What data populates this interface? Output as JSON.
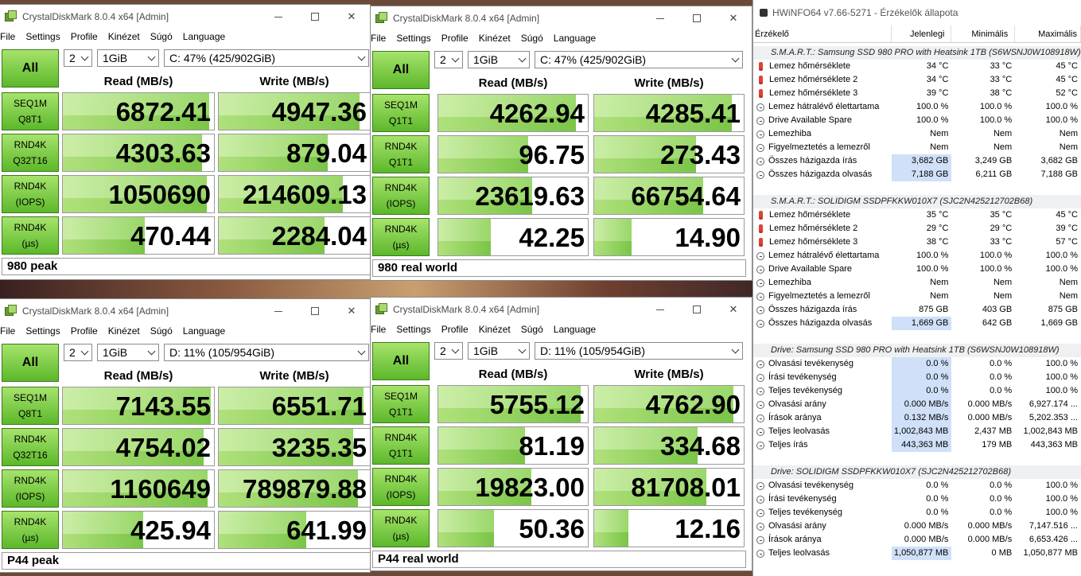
{
  "cdm": {
    "menu": [
      "File",
      "Settings",
      "Profile",
      "Kinézet",
      "Súgó",
      "Language"
    ],
    "all_label": "All",
    "read_header": "Read (MB/s)",
    "write_header": "Write (MB/s)",
    "title": "CrystalDiskMark 8.0.4 x64 [Admin]",
    "windows": [
      {
        "count": "2",
        "size": "1GiB",
        "drive": "C: 47% (425/902GiB)",
        "comment": "980 peak",
        "rows": [
          {
            "l1": "SEQ1M",
            "l2": "Q8T1",
            "read": "6872.41",
            "write": "4947.36",
            "rf": 0.97,
            "wf": 0.93
          },
          {
            "l1": "RND4K",
            "l2": "Q32T16",
            "read": "4303.63",
            "write": "879.04",
            "rf": 0.92,
            "wf": 0.72
          },
          {
            "l1": "RND4K",
            "l2": "(IOPS)",
            "read": "1050690",
            "write": "214609.13",
            "rf": 0.95,
            "wf": 0.82
          },
          {
            "l1": "RND4K",
            "l2": "(µs)",
            "read": "470.44",
            "write": "2284.04",
            "rf": 0.54,
            "wf": 0.7
          }
        ]
      },
      {
        "count": "2",
        "size": "1GiB",
        "drive": "C: 47% (425/902GiB)",
        "comment": "980 real world",
        "rows": [
          {
            "l1": "SEQ1M",
            "l2": "Q1T1",
            "read": "4262.94",
            "write": "4285.41",
            "rf": 0.92,
            "wf": 0.92
          },
          {
            "l1": "RND4K",
            "l2": "Q1T1",
            "read": "96.75",
            "write": "273.43",
            "rf": 0.6,
            "wf": 0.68
          },
          {
            "l1": "RND4K",
            "l2": "(IOPS)",
            "read": "23619.63",
            "write": "66754.64",
            "rf": 0.63,
            "wf": 0.73
          },
          {
            "l1": "RND4K",
            "l2": "(µs)",
            "read": "42.25",
            "write": "14.90",
            "rf": 0.35,
            "wf": 0.25
          }
        ]
      },
      {
        "count": "2",
        "size": "1GiB",
        "drive": "D: 11% (105/954GiB)",
        "comment": "P44 peak",
        "rows": [
          {
            "l1": "SEQ1M",
            "l2": "Q8T1",
            "read": "7143.55",
            "write": "6551.71",
            "rf": 0.98,
            "wf": 0.96
          },
          {
            "l1": "RND4K",
            "l2": "Q32T16",
            "read": "4754.02",
            "write": "3235.35",
            "rf": 0.93,
            "wf": 0.89
          },
          {
            "l1": "RND4K",
            "l2": "(IOPS)",
            "read": "1160649",
            "write": "789879.88",
            "rf": 0.96,
            "wf": 0.92
          },
          {
            "l1": "RND4K",
            "l2": "(µs)",
            "read": "425.94",
            "write": "641.99",
            "rf": 0.53,
            "wf": 0.58
          }
        ]
      },
      {
        "count": "2",
        "size": "1GiB",
        "drive": "D: 11% (105/954GiB)",
        "comment": "P44 real world",
        "rows": [
          {
            "l1": "SEQ1M",
            "l2": "Q1T1",
            "read": "5755.12",
            "write": "4762.90",
            "rf": 0.95,
            "wf": 0.93
          },
          {
            "l1": "RND4K",
            "l2": "Q1T1",
            "read": "81.19",
            "write": "334.68",
            "rf": 0.58,
            "wf": 0.69
          },
          {
            "l1": "RND4K",
            "l2": "(IOPS)",
            "read": "19823.00",
            "write": "81708.01",
            "rf": 0.62,
            "wf": 0.75
          },
          {
            "l1": "RND4K",
            "l2": "(µs)",
            "read": "50.36",
            "write": "12.16",
            "rf": 0.37,
            "wf": 0.23
          }
        ]
      }
    ]
  },
  "hwinfo": {
    "title": "HWiNFO64 v7.66-5271 - Érzékelők állapota",
    "columns": [
      "Érzékelő",
      "Jelenlegi",
      "Minimális",
      "Maximális"
    ],
    "sections": [
      {
        "title": "S.M.A.R.T.: Samsung SSD 980 PRO with Heatsink 1TB (S6WSNJ0W108918W)",
        "rows": [
          {
            "icon": "therm",
            "name": "Lemez hőmérséklete",
            "cur": "34 °C",
            "min": "33 °C",
            "max": "45 °C",
            "hl": false
          },
          {
            "icon": "therm",
            "name": "Lemez hőmérséklete 2",
            "cur": "34 °C",
            "min": "33 °C",
            "max": "45 °C",
            "hl": false
          },
          {
            "icon": "therm",
            "name": "Lemez hőmérséklete 3",
            "cur": "39 °C",
            "min": "38 °C",
            "max": "52 °C",
            "hl": false
          },
          {
            "icon": "clock",
            "name": "Lemez hátralévő élettartama",
            "cur": "100.0 %",
            "min": "100.0 %",
            "max": "100.0 %",
            "hl": false
          },
          {
            "icon": "clock",
            "name": "Drive Available Spare",
            "cur": "100.0 %",
            "min": "100.0 %",
            "max": "100.0 %",
            "hl": false
          },
          {
            "icon": "clock",
            "name": "Lemezhiba",
            "cur": "Nem",
            "min": "Nem",
            "max": "Nem",
            "hl": false
          },
          {
            "icon": "clock",
            "name": "Figyelmeztetés a lemezről",
            "cur": "Nem",
            "min": "Nem",
            "max": "Nem",
            "hl": false
          },
          {
            "icon": "clock",
            "name": "Összes házigazda írás",
            "cur": "3,682 GB",
            "min": "3,249 GB",
            "max": "3,682 GB",
            "hl": true
          },
          {
            "icon": "clock",
            "name": "Összes házigazda olvasás",
            "cur": "7,188 GB",
            "min": "6,211 GB",
            "max": "7,188 GB",
            "hl": true
          }
        ]
      },
      {
        "title": "S.M.A.R.T.: SOLIDIGM SSDPFKKW010X7 (SJC2N425212702B68)",
        "rows": [
          {
            "icon": "therm",
            "name": "Lemez hőmérséklete",
            "cur": "35 °C",
            "min": "35 °C",
            "max": "45 °C",
            "hl": false
          },
          {
            "icon": "therm",
            "name": "Lemez hőmérséklete 2",
            "cur": "29 °C",
            "min": "29 °C",
            "max": "39 °C",
            "hl": false
          },
          {
            "icon": "therm",
            "name": "Lemez hőmérséklete 3",
            "cur": "38 °C",
            "min": "33 °C",
            "max": "57 °C",
            "hl": false
          },
          {
            "icon": "clock",
            "name": "Lemez hátralévő élettartama",
            "cur": "100.0 %",
            "min": "100.0 %",
            "max": "100.0 %",
            "hl": false
          },
          {
            "icon": "clock",
            "name": "Drive Available Spare",
            "cur": "100.0 %",
            "min": "100.0 %",
            "max": "100.0 %",
            "hl": false
          },
          {
            "icon": "clock",
            "name": "Lemezhiba",
            "cur": "Nem",
            "min": "Nem",
            "max": "Nem",
            "hl": false
          },
          {
            "icon": "clock",
            "name": "Figyelmeztetés a lemezről",
            "cur": "Nem",
            "min": "Nem",
            "max": "Nem",
            "hl": false
          },
          {
            "icon": "clock",
            "name": "Összes házigazda írás",
            "cur": "875 GB",
            "min": "403 GB",
            "max": "875 GB",
            "hl": false
          },
          {
            "icon": "clock",
            "name": "Összes házigazda olvasás",
            "cur": "1,669 GB",
            "min": "642 GB",
            "max": "1,669 GB",
            "hl": true
          }
        ]
      },
      {
        "title": "Drive: Samsung SSD 980 PRO with Heatsink 1TB (S6WSNJ0W108918W)",
        "rows": [
          {
            "icon": "clock",
            "name": "Olvasási tevékenység",
            "cur": "0.0 %",
            "min": "0.0 %",
            "max": "100.0 %",
            "hl": true
          },
          {
            "icon": "clock",
            "name": "Írási tevékenység",
            "cur": "0.0 %",
            "min": "0.0 %",
            "max": "100.0 %",
            "hl": true
          },
          {
            "icon": "clock",
            "name": "Teljes tevékenység",
            "cur": "0.0 %",
            "min": "0.0 %",
            "max": "100.0 %",
            "hl": true
          },
          {
            "icon": "clock",
            "name": "Olvasási arány",
            "cur": "0.000 MB/s",
            "min": "0.000 MB/s",
            "max": "6,927.174 ...",
            "hl": true
          },
          {
            "icon": "clock",
            "name": "Írások aránya",
            "cur": "0.132 MB/s",
            "min": "0.000 MB/s",
            "max": "5,202.353 ...",
            "hl": true
          },
          {
            "icon": "clock",
            "name": "Teljes leolvasás",
            "cur": "1,002,843 MB",
            "min": "2,437 MB",
            "max": "1,002,843 MB",
            "hl": true
          },
          {
            "icon": "clock",
            "name": "Teljes írás",
            "cur": "443,363 MB",
            "min": "179 MB",
            "max": "443,363 MB",
            "hl": true
          }
        ]
      },
      {
        "title": "Drive: SOLIDIGM SSDPFKKW010X7 (SJC2N425212702B68)",
        "rows": [
          {
            "icon": "clock",
            "name": "Olvasási tevékenység",
            "cur": "0.0 %",
            "min": "0.0 %",
            "max": "100.0 %",
            "hl": false
          },
          {
            "icon": "clock",
            "name": "Írási tevékenység",
            "cur": "0.0 %",
            "min": "0.0 %",
            "max": "100.0 %",
            "hl": false
          },
          {
            "icon": "clock",
            "name": "Teljes tevékenység",
            "cur": "0.0 %",
            "min": "0.0 %",
            "max": "100.0 %",
            "hl": false
          },
          {
            "icon": "clock",
            "name": "Olvasási arány",
            "cur": "0.000 MB/s",
            "min": "0.000 MB/s",
            "max": "7,147.516 ...",
            "hl": false
          },
          {
            "icon": "clock",
            "name": "Írások aránya",
            "cur": "0.000 MB/s",
            "min": "0.000 MB/s",
            "max": "6,653.426 ...",
            "hl": false
          },
          {
            "icon": "clock",
            "name": "Teljes leolvasás",
            "cur": "1,050,877 MB",
            "min": "0 MB",
            "max": "1,050,877 MB",
            "hl": true
          }
        ]
      }
    ]
  }
}
